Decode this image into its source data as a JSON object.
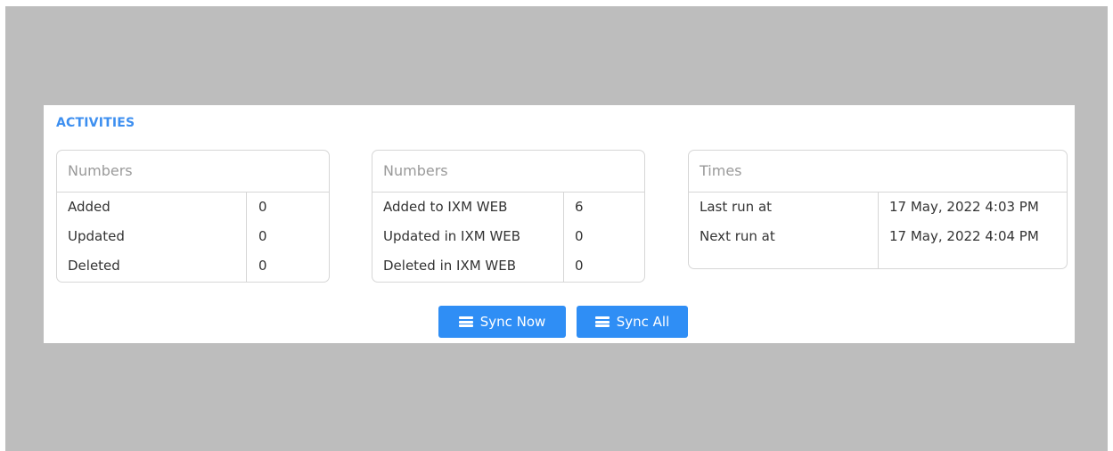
{
  "activities": {
    "title": "ACTIVITIES",
    "cards": [
      {
        "header": "Numbers",
        "rows": [
          {
            "label": "Added",
            "value": "0"
          },
          {
            "label": "Updated",
            "value": "0"
          },
          {
            "label": "Deleted",
            "value": "0"
          }
        ]
      },
      {
        "header": "Numbers",
        "rows": [
          {
            "label": "Added to IXM WEB",
            "value": "6"
          },
          {
            "label": "Updated in IXM WEB",
            "value": "0"
          },
          {
            "label": "Deleted in IXM WEB",
            "value": "0"
          }
        ]
      },
      {
        "header": "Times",
        "rows": [
          {
            "label": "Last run at",
            "value": "17 May, 2022 4:03 PM"
          },
          {
            "label": "Next run at",
            "value": "17 May, 2022 4:04 PM"
          }
        ]
      }
    ],
    "buttons": {
      "sync_now": {
        "label": "Sync Now",
        "icon": "server-icon"
      },
      "sync_all": {
        "label": "Sync All",
        "icon": "server-icon"
      }
    }
  },
  "colors": {
    "accent": "#2f8ef5",
    "title": "#3d8ff0",
    "backdrop": "#bdbdbd"
  }
}
